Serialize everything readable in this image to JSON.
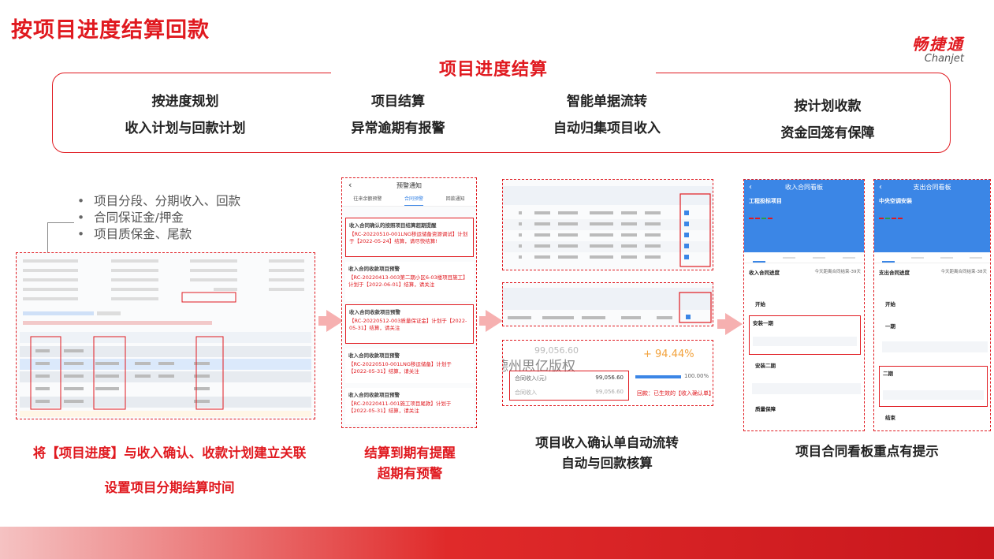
{
  "page": {
    "title": "按项目进度结算回款",
    "logo_cn": "畅捷通",
    "logo_en": "Chanjet"
  },
  "banner": {
    "title": "项目进度结算",
    "features": [
      {
        "line1": "按进度规划",
        "line2": "收入计划与回款计划"
      },
      {
        "line1": "项目结算",
        "line2": "异常逾期有报警"
      },
      {
        "line1": "智能单据流转",
        "line2": "自动归集项目收入"
      },
      {
        "line1": "按计划收款",
        "line2": "资金回笼有保障"
      }
    ]
  },
  "bullets": [
    "项目分段、分期收入、回款",
    "合同保证金/押金",
    "项目质保金、尾款"
  ],
  "panels": {
    "p1": {
      "caption1": "将【项目进度】与收入确认、收款计划建立关联",
      "caption2": "设置项目分期结算时间"
    },
    "p2": {
      "header": "预警通知",
      "tabs": [
        "往来余额预警",
        "合同预警",
        "回款通知"
      ],
      "cards": [
        {
          "title": "收入合同确认的按照项目结算超期提醒",
          "time": "05/25 07:15",
          "body": "【RC-20220510-001LNG移运储备资源调试】计划于【2022-05-24】结算，请尽快结算!"
        },
        {
          "title": "收入合同收款项目预警",
          "time": "05/25 09:25",
          "body": "【RC-20220413-003第二期小区6-03楼项目施工】计划于【2022-06-01】结算，请关注"
        },
        {
          "title": "收入合同收款项目预警",
          "time": "05/25 09:25",
          "body": "【RC-20220512-003质量保证金】计划于【2022-05-31】结算，请关注"
        },
        {
          "title": "收入合同收款项目预警",
          "time": "05/25 09:25",
          "body": "【RC-20220510-001LNG移运储备】计划于【2022-05-31】结算，请关注"
        },
        {
          "title": "收入合同收款项目预警",
          "time": "05/25 09:25",
          "body": "【RC-20220411-001施工项目尾款】计划于【2022-05-31】结算，请关注"
        }
      ],
      "caption1": "结算到期有提醒",
      "caption2": "超期有预警"
    },
    "p3": {
      "amount_top": "99,056.60",
      "growth": "+ 94.44%",
      "watermark": "德州思亿版权",
      "label_income": "合同收入(元)",
      "value_income": "99,056.60",
      "label_collected": "合同收入",
      "value_collected": "99,056.60",
      "progress_pct": "100.00%",
      "note": "回款：已生效的【收入确认单】",
      "caption1": "项目收入确认单自动流转",
      "caption2": "自动与回款核算"
    },
    "p4": {
      "phone1_title": "收入合同看板",
      "phone1_project": "工程投标项目",
      "phone1_section": "收入合同进度",
      "phone1_remaining": "今天距离合同结束-39天",
      "phone1_items": [
        "开始",
        "安装一期",
        "安装二期",
        "质量保障"
      ],
      "phone2_title": "支出合同看板",
      "phone2_project": "中央空调安装",
      "phone2_section": "支出合同进度",
      "phone2_remaining": "今天距离合同结束-38天",
      "phone2_items": [
        "开始",
        "一期",
        "二期",
        "结束"
      ],
      "caption": "项目合同看板重点有提示"
    }
  },
  "colors": {
    "accent": "#e0191f",
    "blue": "#3b86e6",
    "arrow": "#f6b0b0"
  }
}
